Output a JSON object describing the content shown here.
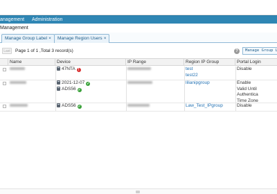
{
  "nav": {
    "items": [
      {
        "label": "anagement"
      },
      {
        "label": "Administration"
      }
    ]
  },
  "breadcrumb": "Management",
  "tabs": [
    {
      "label": "Manage Group Label",
      "close": "×"
    },
    {
      "label": "Manage Region Users",
      "close": "×"
    }
  ],
  "toolbar": {
    "page_button": "Last",
    "page_info": "Page 1 of 1 ,Total 3 record(s)",
    "help_symbol": "?",
    "manage_button": "Manage Group Label"
  },
  "table": {
    "columns": [
      "Name",
      "Device",
      "IP Range",
      "Region IP Group",
      "Portal Login"
    ],
    "rows": [
      {
        "devices": [
          {
            "name": "47NTA",
            "status": "error",
            "status_symbol": "!"
          }
        ],
        "groups": [
          "test",
          "test22"
        ],
        "portal": [
          "Disable"
        ]
      },
      {
        "devices": [
          {
            "name": "2021-12-07",
            "status": "ok",
            "status_symbol": "✓"
          },
          {
            "name": "ADS56",
            "status": "ok",
            "status_symbol": "✓"
          }
        ],
        "groups": [
          "lilianipgroup"
        ],
        "portal": [
          "Enable",
          "Valid Until",
          "Authentica",
          "Time Zone"
        ]
      },
      {
        "devices": [
          {
            "name": "ADS56",
            "status": "ok",
            "status_symbol": "✓"
          }
        ],
        "groups": [
          "Law_Test_IPgroup"
        ],
        "portal": [
          "Disable"
        ]
      }
    ]
  },
  "colors": {
    "nav_bar": "#2f86b4",
    "tab_border": "#8fb8d6",
    "link": "#1f6fb2",
    "status_ok": "#3aa13a",
    "status_error": "#d93030"
  }
}
